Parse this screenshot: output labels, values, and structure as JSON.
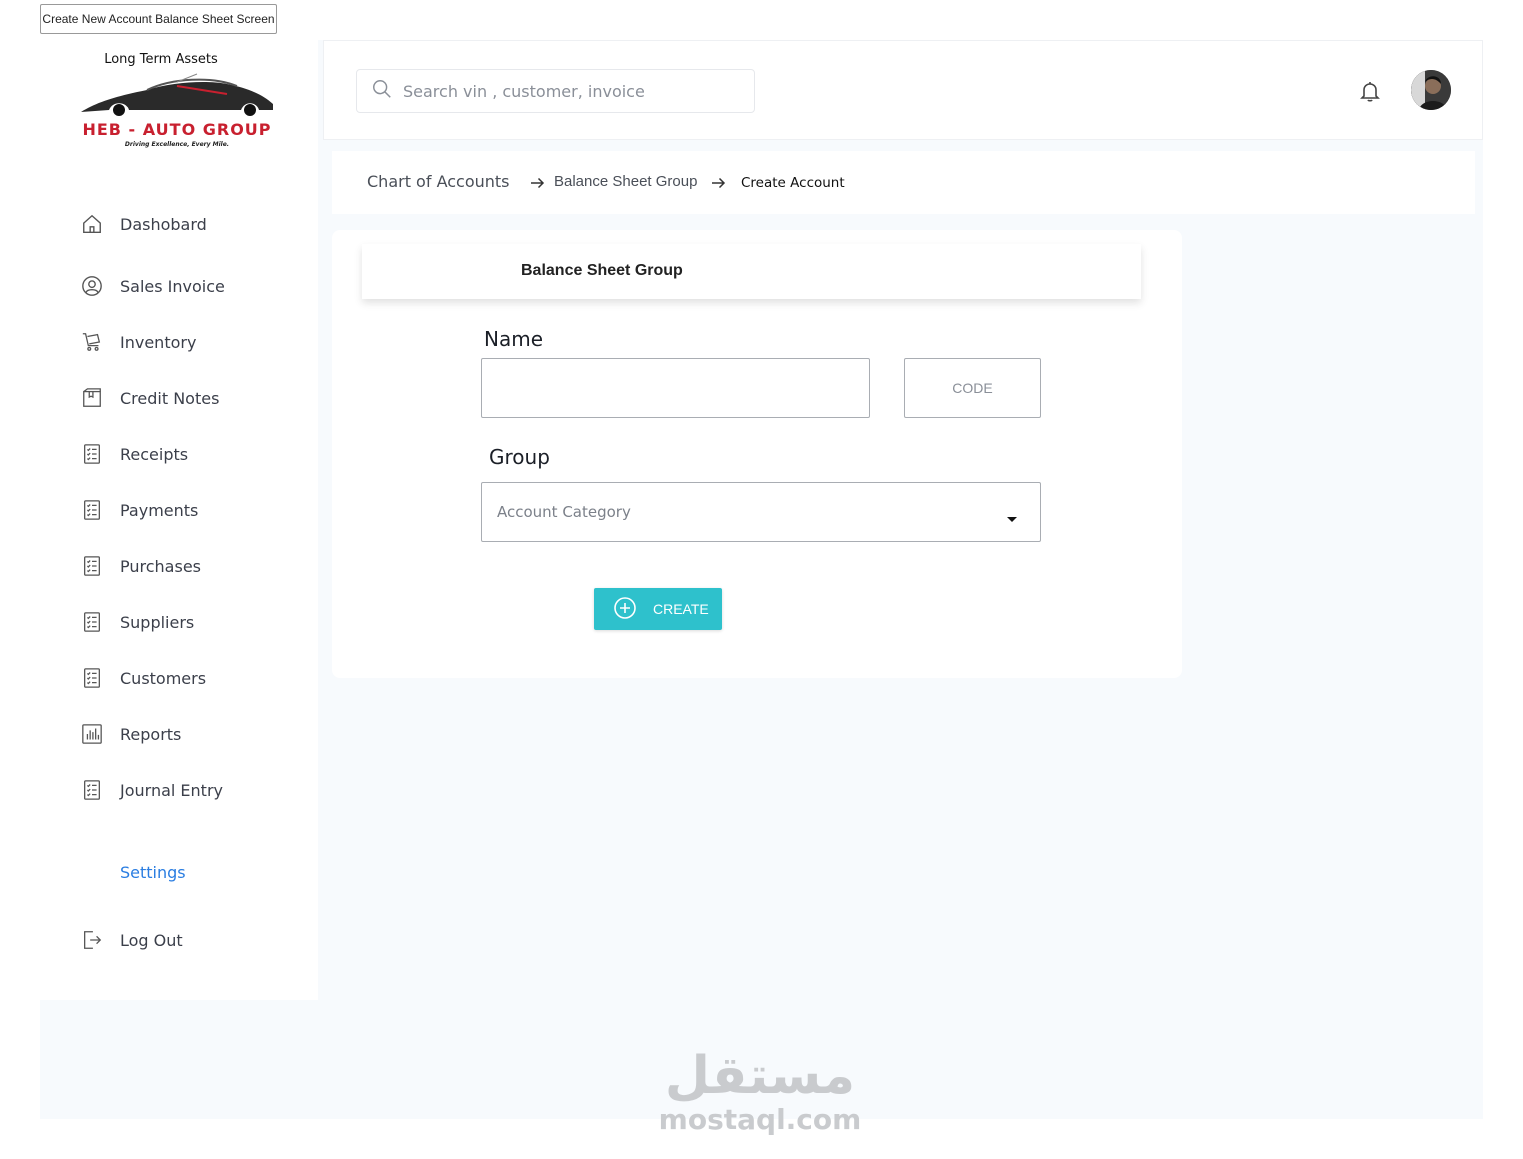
{
  "frame": {
    "title": "Create New Account Balance Sheet Screen"
  },
  "brand": {
    "subtitle": "Long Term Assets",
    "name": "HEB - AUTO GROUP",
    "tagline": "Driving Excellence, Every Mile.",
    "accent": "#c8202f"
  },
  "sidebar": {
    "items": [
      {
        "label": "Dashobard",
        "icon": "home-icon"
      },
      {
        "label": "Sales Invoice",
        "icon": "user-circle-icon"
      },
      {
        "label": "Inventory",
        "icon": "cart-icon"
      },
      {
        "label": "Credit Notes",
        "icon": "box-icon"
      },
      {
        "label": "Receipts",
        "icon": "checklist-icon"
      },
      {
        "label": "Payments",
        "icon": "checklist-icon"
      },
      {
        "label": "Purchases",
        "icon": "checklist-icon"
      },
      {
        "label": "Suppliers",
        "icon": "checklist-icon"
      },
      {
        "label": "Customers",
        "icon": "checklist-icon"
      },
      {
        "label": "Reports",
        "icon": "bar-chart-icon"
      },
      {
        "label": "Journal Entry",
        "icon": "checklist-icon"
      }
    ],
    "settings_label": "Settings",
    "logout_label": "Log Out",
    "settings_color": "#2a7de1"
  },
  "header": {
    "search_placeholder": "Search vin , customer, invoice",
    "notification_icon": "bell-icon",
    "avatar_icon": "avatar"
  },
  "breadcrumb": {
    "items": [
      "Chart of Accounts",
      "Balance Sheet Group",
      "Create Account"
    ]
  },
  "form": {
    "title": "Balance Sheet Group",
    "name_label": "Name",
    "name_value": "",
    "code_placeholder": "CODE",
    "group_label": "Group",
    "group_selected": "Account Category",
    "create_label": "CREATE",
    "button_color": "#2ec1cc"
  },
  "watermark": {
    "arabic": "مستقل",
    "latin": "mostaql.com"
  }
}
